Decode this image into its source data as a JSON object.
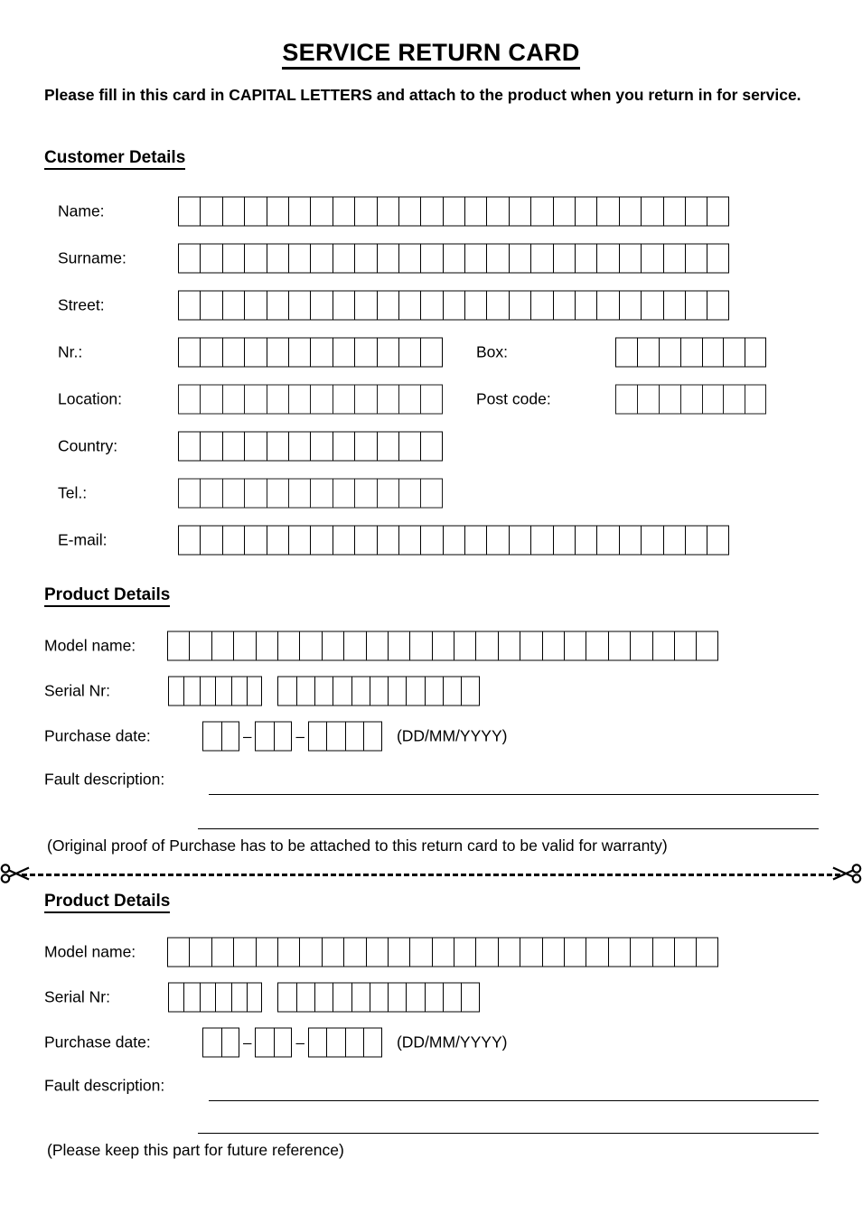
{
  "document": {
    "title": "SERVICE RETURN CARD",
    "instruction": "Please fill in this card in CAPITAL LETTERS and attach to the product when you return in for service."
  },
  "customer_details": {
    "heading": "Customer Details",
    "fields": [
      {
        "label": "Name:",
        "boxes": 25
      },
      {
        "label": "Surname:",
        "boxes": 25
      },
      {
        "label": "Street:",
        "boxes": 25
      },
      {
        "label": "Nr.:",
        "boxes": 12,
        "label2": "Box:",
        "boxes2": 7
      },
      {
        "label": "Location:",
        "boxes": 12,
        "label2": "Post code:",
        "boxes2": 7
      },
      {
        "label": "Country:",
        "boxes": 12
      },
      {
        "label": "Tel.:",
        "boxes": 12
      },
      {
        "label": "E-mail:",
        "boxes": 25
      }
    ]
  },
  "product_details_top": {
    "heading": "Product Details",
    "model_name_label": "Model name:",
    "model_name_boxes": 25,
    "serial_nr_label": "Serial Nr:",
    "serial_group_1_boxes": 6,
    "serial_group_2_boxes": 11,
    "purchase_date_label": "Purchase date:",
    "purchase_day_boxes": 2,
    "purchase_month_boxes": 2,
    "purchase_year_boxes": 4,
    "date_separator": "–",
    "date_format_hint": "(DD/MM/YYYY)",
    "fault_description_label": "Fault description:",
    "note": "(Original proof of Purchase has to be attached to this return card to be valid for warranty)"
  },
  "cut_line": {
    "scissors_icon_left": "scissors-icon",
    "scissors_icon_right": "scissors-icon"
  },
  "product_details_bottom": {
    "heading": "Product Details",
    "model_name_label": "Model name:",
    "model_name_boxes": 25,
    "serial_nr_label": "Serial Nr:",
    "serial_group_1_boxes": 6,
    "serial_group_2_boxes": 11,
    "purchase_date_label": "Purchase date:",
    "purchase_day_boxes": 2,
    "purchase_month_boxes": 2,
    "purchase_year_boxes": 4,
    "date_separator": "–",
    "date_format_hint": "(DD/MM/YYYY)",
    "fault_description_label": "Fault description:",
    "note": "(Please keep this part for future reference)"
  },
  "colors": {
    "ink": "#000000",
    "paper": "#ffffff"
  }
}
